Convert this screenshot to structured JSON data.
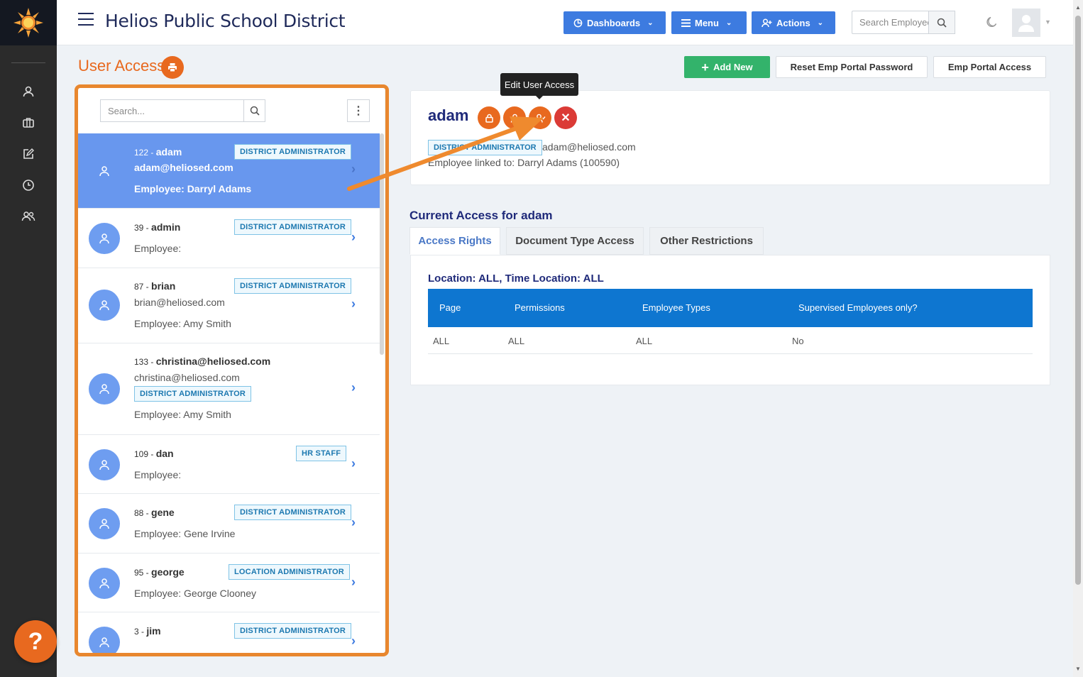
{
  "app": {
    "title": "Helios Public School District"
  },
  "topbar": {
    "dashboards": "Dashboards",
    "menu": "Menu",
    "actions": "Actions",
    "search_placeholder": "Search Employee..."
  },
  "page": {
    "title": "User Access",
    "add_new": "Add New",
    "reset_password": "Reset Emp Portal Password",
    "portal_access": "Emp Portal Access"
  },
  "list": {
    "search_placeholder": "Search...",
    "users": [
      {
        "id": "122 -",
        "name": "adam",
        "email": "adam@heliosed.com",
        "employee": "Employee: Darryl Adams",
        "role": "DISTRICT ADMINISTRATOR"
      },
      {
        "id": "39 -",
        "name": "admin",
        "email": "",
        "employee": "Employee:",
        "role": "DISTRICT ADMINISTRATOR"
      },
      {
        "id": "87 -",
        "name": "brian",
        "email": "brian@heliosed.com",
        "employee": "Employee: Amy Smith",
        "role": "DISTRICT ADMINISTRATOR"
      },
      {
        "id": "133 -",
        "name": "christina@heliosed.com",
        "email": "christina@heliosed.com",
        "employee": "Employee: Amy Smith",
        "role": "DISTRICT ADMINISTRATOR"
      },
      {
        "id": "109 -",
        "name": "dan",
        "email": "",
        "employee": "Employee:",
        "role": "HR STAFF"
      },
      {
        "id": "88 -",
        "name": "gene",
        "email": "",
        "employee": "Employee: Gene Irvine",
        "role": "DISTRICT ADMINISTRATOR"
      },
      {
        "id": "95 -",
        "name": "george",
        "email": "",
        "employee": "Employee: George Clooney",
        "role": "LOCATION ADMINISTRATOR"
      },
      {
        "id": "3 -",
        "name": "jim",
        "email": "",
        "employee": "",
        "role": "DISTRICT ADMINISTRATOR"
      }
    ]
  },
  "detail": {
    "name": "adam",
    "role": "DISTRICT ADMINISTRATOR",
    "email": "adam@heliosed.com",
    "linked": "Employee linked to: Darryl Adams (100590)",
    "tooltip": "Edit User Access"
  },
  "access": {
    "title": "Current Access for adam",
    "tabs": [
      "Access Rights",
      "Document Type Access",
      "Other Restrictions"
    ],
    "location_line": "Location: ALL, Time Location: ALL",
    "columns": [
      "Page",
      "Permissions",
      "Employee Types",
      "Supervised Employees only?"
    ],
    "rows": [
      [
        "ALL",
        "ALL",
        "ALL",
        "No"
      ]
    ]
  },
  "colors": {
    "accent": "#e8691f",
    "primary": "#3d7be0",
    "success": "#33b36b",
    "navy": "#1f2a7a"
  }
}
